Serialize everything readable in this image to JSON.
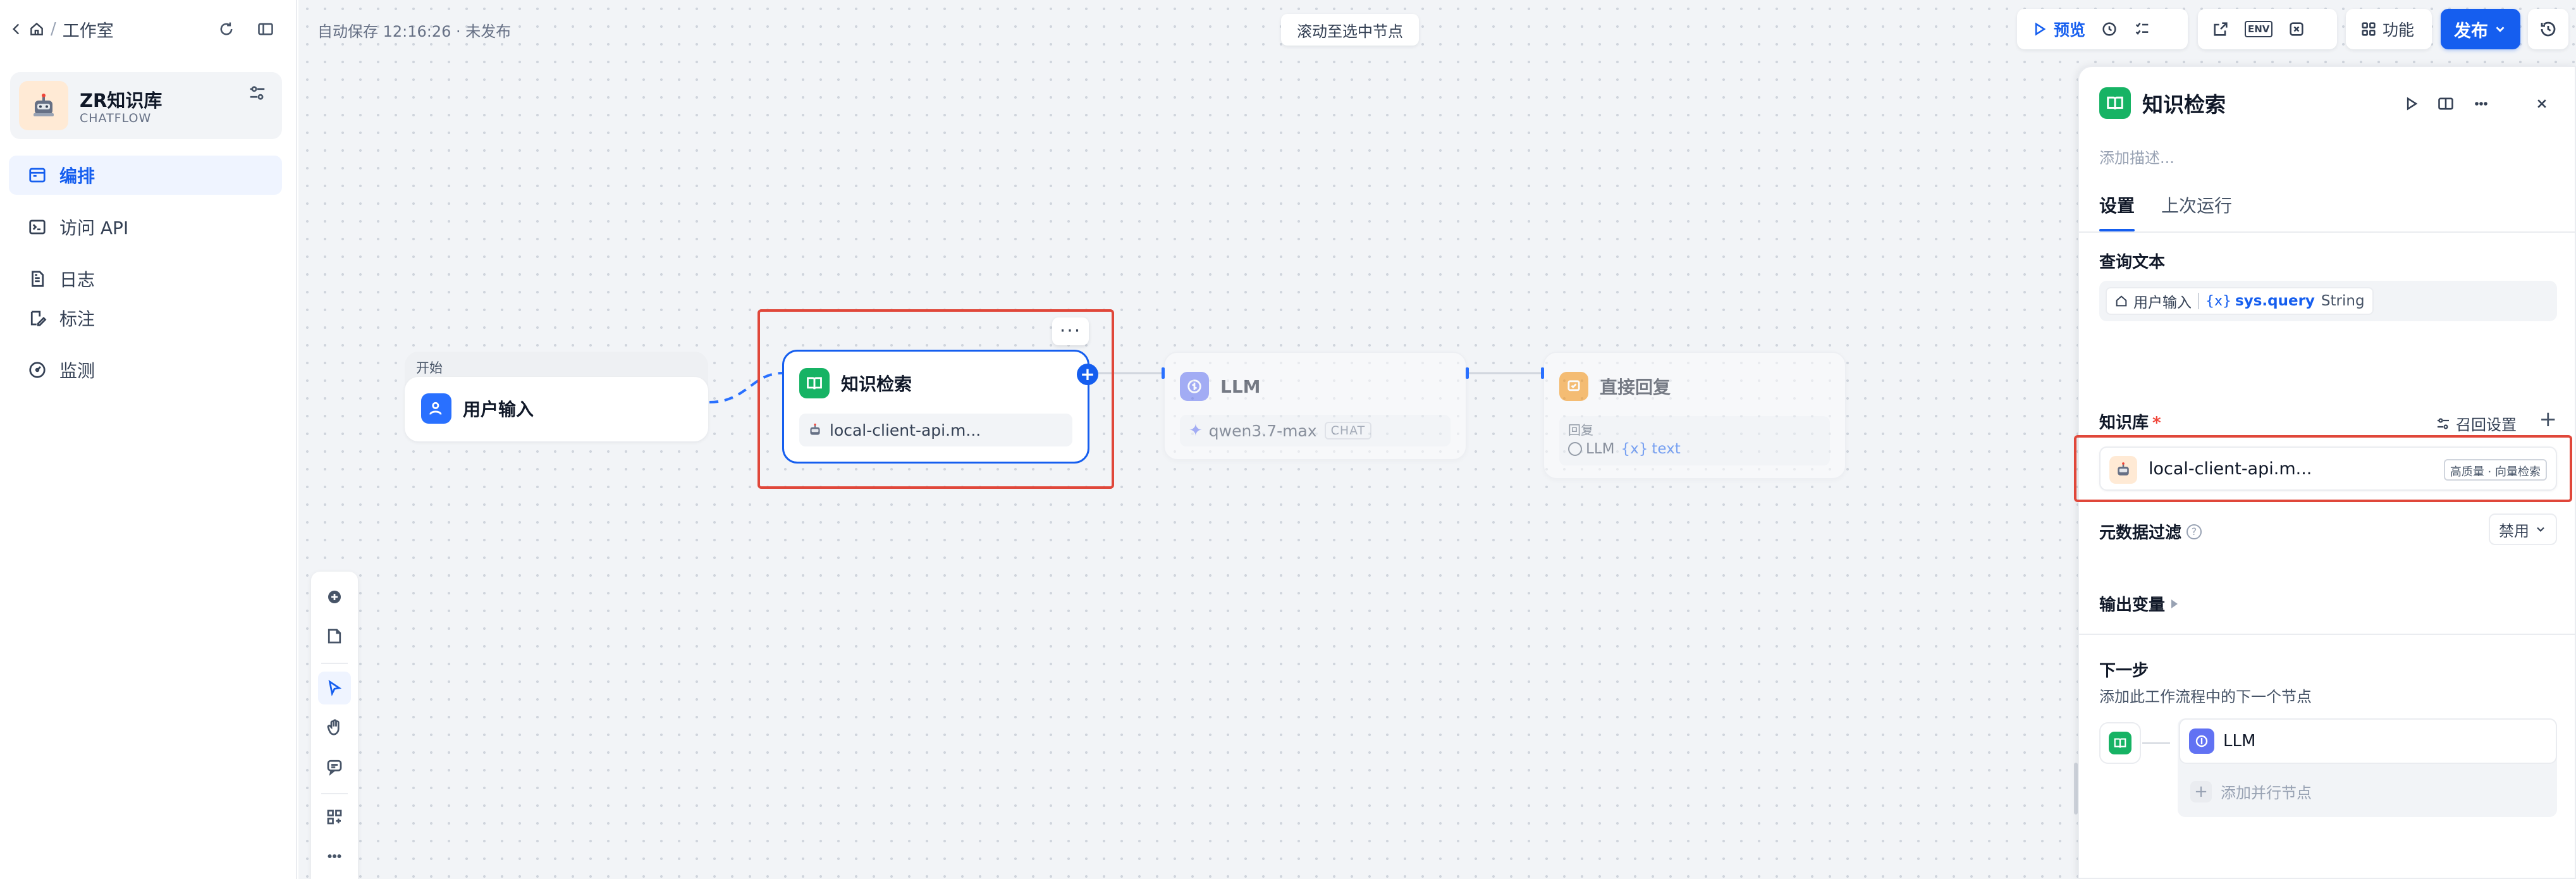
{
  "breadcrumb": {
    "workspace": "工作室"
  },
  "app": {
    "name": "ZR知识库",
    "mode": "CHATFLOW"
  },
  "nav": {
    "items": [
      {
        "label": "编排",
        "icon": "layout-icon",
        "active": true
      },
      {
        "label": "访问 API",
        "icon": "terminal-icon",
        "active": false
      },
      {
        "label": "日志",
        "icon": "log-icon",
        "active": false
      },
      {
        "label": "标注",
        "icon": "annotation-icon",
        "active": false
      },
      {
        "label": "监测",
        "icon": "monitor-icon",
        "active": false
      }
    ]
  },
  "canvas": {
    "autosave": "自动保存 12:16:26 · 未发布",
    "scroll_to_selected": "滚动至选中节点"
  },
  "toolbar": {
    "preview": "预览",
    "env": "ENV",
    "features": "功能",
    "publish": "发布"
  },
  "nodes": {
    "start": {
      "caption": "开始",
      "title": "用户输入"
    },
    "knowledge": {
      "title": "知识检索",
      "dataset": "local-client-api.m..."
    },
    "llm": {
      "title": "LLM",
      "model": "qwen3.7-max",
      "model_tag": "CHAT"
    },
    "answer": {
      "title": "直接回复",
      "reply_label": "回复",
      "reply_node": "LLM",
      "reply_var": "text"
    }
  },
  "panel": {
    "title": "知识检索",
    "description_placeholder": "添加描述...",
    "tabs": [
      {
        "label": "设置",
        "active": true
      },
      {
        "label": "上次运行",
        "active": false
      }
    ],
    "query": {
      "label": "查询文本",
      "source_node": "用户输入",
      "var_name": "sys.query",
      "var_type": "String"
    },
    "knowledge": {
      "label": "知识库",
      "recall_settings": "召回设置",
      "item_name": "local-client-api.m...",
      "item_badge": "高质量 · 向量检索"
    },
    "metadata_filter": {
      "label": "元数据过滤",
      "value": "禁用"
    },
    "output_vars": {
      "label": "输出变量"
    },
    "next_step": {
      "label": "下一步",
      "description": "添加此工作流程中的下一个节点",
      "next_node": "LLM",
      "add_parallel": "添加并行节点"
    }
  },
  "colors": {
    "accent": "#155eef",
    "highlight_frame": "#e0473a",
    "knowledge_node": "#16b364",
    "llm_node": "#6172f3",
    "answer_node": "#f79009",
    "start_node": "#2970ff"
  }
}
